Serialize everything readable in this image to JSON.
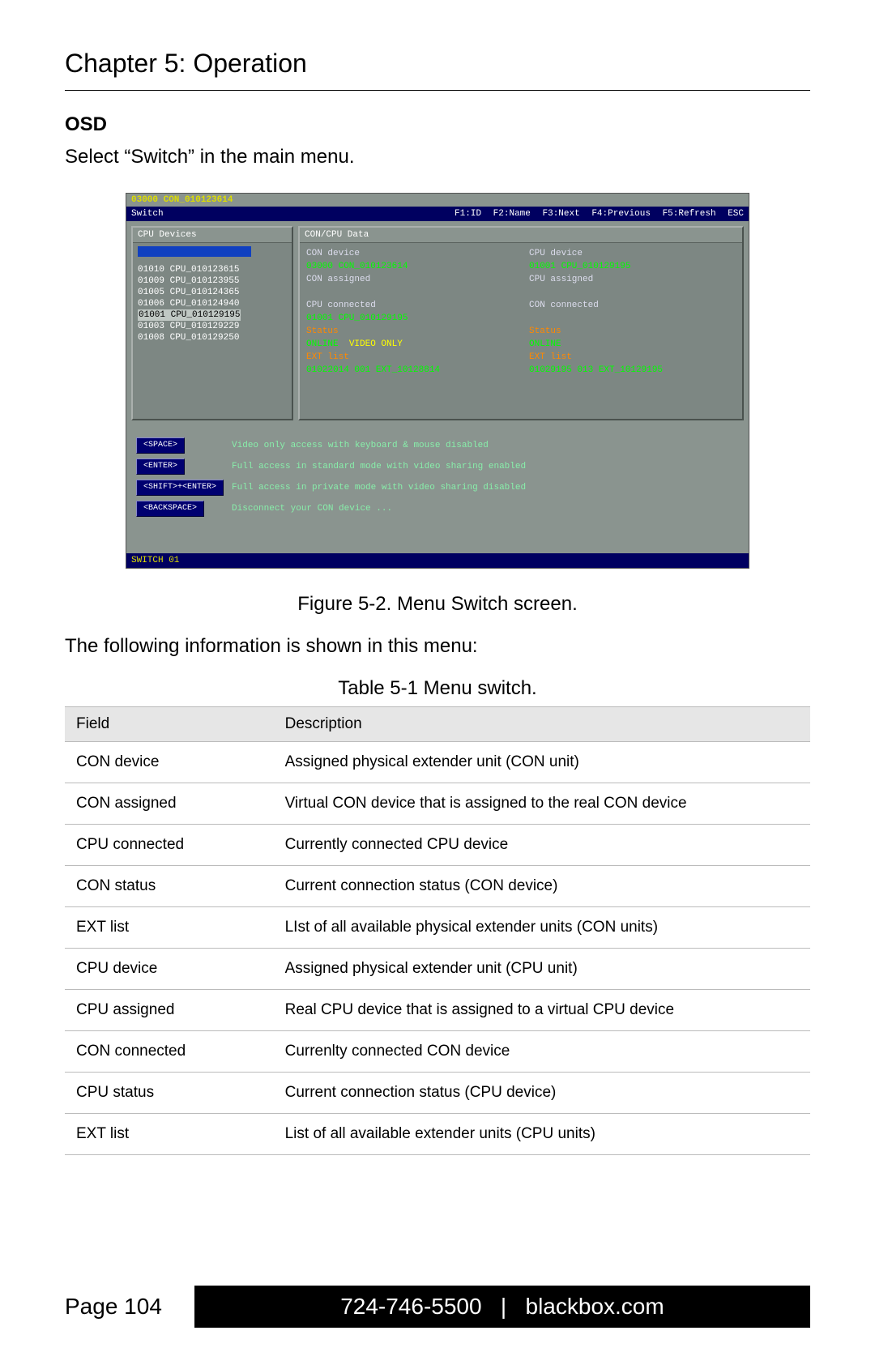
{
  "chapter_title": "Chapter 5: Operation",
  "osd_heading": "OSD",
  "instruction": "Select “Switch” in the main menu.",
  "osd": {
    "topline": "03000 CON_010123614",
    "menu_left": "Switch",
    "fn_keys": [
      "F1:ID",
      "F2:Name",
      "F3:Next",
      "F4:Previous",
      "F5:Refresh",
      "ESC"
    ],
    "left_panel_title": "CPU Devices",
    "right_panel_title": "CON/CPU Data",
    "cpu_rows": [
      "01010 CPU_010123615",
      "01009 CPU_010123955",
      "01005 CPU_010124365",
      "01006 CPU_010124940"
    ],
    "cpu_highlight": "01001 CPU_010129195",
    "cpu_after": [
      "01003 CPU_010129229",
      "01008 CPU_010129250"
    ],
    "data_left": {
      "con_device_lbl": "CON device",
      "con_device_val": "03000 CON_010123614",
      "con_assigned_lbl": "CON assigned",
      "cpu_connected_lbl": "CPU connected",
      "cpu_connected_val": "01001 CPU_010129195",
      "status_lbl": "Status",
      "status_val1": "ONLINE",
      "status_val2": "VIDEO ONLY",
      "ext_lbl": "EXT list",
      "ext_val": "01022014 001 EXT_10128814"
    },
    "data_right": {
      "cpu_device_lbl": "CPU device",
      "cpu_device_val": "01001 CPU_010129195",
      "cpu_assigned_lbl": "CPU assigned",
      "con_connected_lbl": "CON connected",
      "status_lbl": "Status",
      "status_val": "ONLINE",
      "ext_lbl": "EXT list",
      "ext_val": "01029195 013 EXT_10129195"
    },
    "keys": [
      {
        "key": "<SPACE>",
        "desc": "Video only access with keyboard & mouse disabled"
      },
      {
        "key": "<ENTER>",
        "desc": "Full access in standard mode with video sharing enabled"
      },
      {
        "key": "<SHIFT>+<ENTER>",
        "desc": "Full access in private mode with video sharing disabled"
      },
      {
        "key": "<BACKSPACE>",
        "desc": "Disconnect your CON device ..."
      }
    ],
    "bottom": "SWITCH 01"
  },
  "figure_caption": "Figure 5-2. Menu Switch screen.",
  "para": "The following information is shown in this menu:",
  "table_caption": "Table 5-1 Menu switch.",
  "table": {
    "headers": [
      "Field",
      "Description"
    ],
    "rows": [
      [
        "CON device",
        "Assigned physical extender unit (CON unit)"
      ],
      [
        "CON assigned",
        "Virtual CON device that is assigned to the real CON device"
      ],
      [
        "CPU connected",
        "Currently connected CPU device"
      ],
      [
        "CON status",
        "Current connection status (CON device)"
      ],
      [
        "EXT list",
        "LIst of all available physical extender units (CON units)"
      ],
      [
        "CPU device",
        "Assigned physical extender unit (CPU unit)"
      ],
      [
        "CPU assigned",
        "Real CPU device that is assigned to a virtual CPU device"
      ],
      [
        "CON connected",
        "Currenlty connected CON device"
      ],
      [
        "CPU status",
        "Current connection status (CPU device)"
      ],
      [
        "EXT list",
        "List of all available extender units (CPU units)"
      ]
    ]
  },
  "footer": {
    "page": "Page 104",
    "phone": "724-746-5500",
    "site": "blackbox.com"
  }
}
